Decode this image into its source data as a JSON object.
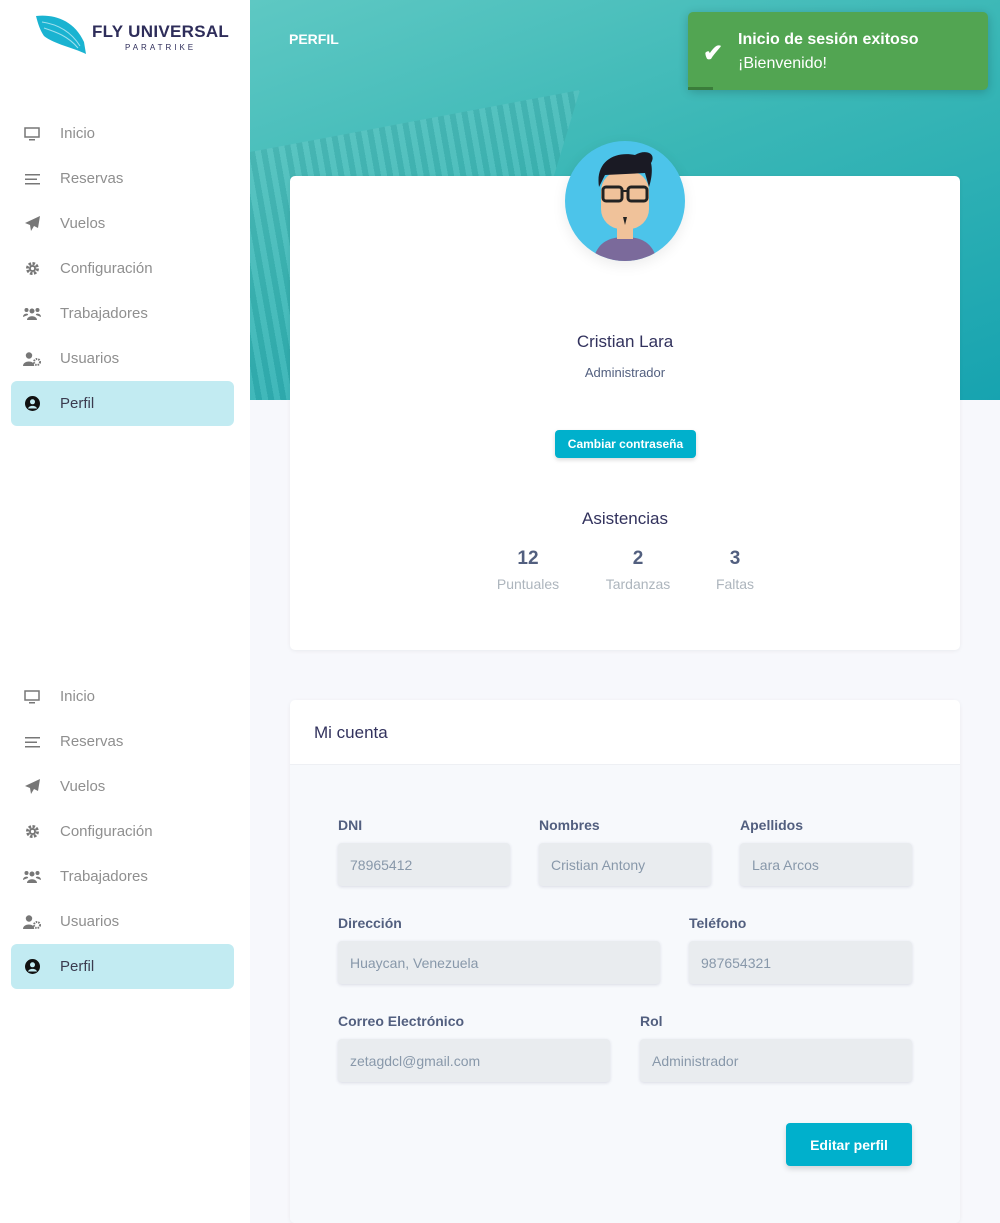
{
  "brand": {
    "name": "FLY UNIVERSAL",
    "tagline": "PARATRIKE"
  },
  "sidebar": {
    "items": [
      {
        "label": "Inicio",
        "icon": "monitor-icon"
      },
      {
        "label": "Reservas",
        "icon": "list-icon"
      },
      {
        "label": "Vuelos",
        "icon": "paper-plane-icon"
      },
      {
        "label": "Configuración",
        "icon": "gear-icon"
      },
      {
        "label": "Trabajadores",
        "icon": "users-icon"
      },
      {
        "label": "Usuarios",
        "icon": "user-cog-icon"
      },
      {
        "label": "Perfil",
        "icon": "user-circle-icon",
        "active": true
      }
    ]
  },
  "header": {
    "title": "PERFIL"
  },
  "toast": {
    "title": "Inicio de sesión exitoso",
    "message": "¡Bienvenido!",
    "color": "#52a552"
  },
  "profile": {
    "name": "Cristian Lara",
    "role": "Administrador",
    "change_password": "Cambiar contraseña",
    "attendance_title": "Asistencias",
    "stats": [
      {
        "value": "12",
        "label": "Puntuales"
      },
      {
        "value": "2",
        "label": "Tardanzas"
      },
      {
        "value": "3",
        "label": "Faltas"
      }
    ]
  },
  "account": {
    "title": "Mi cuenta",
    "fields": {
      "dni": {
        "label": "DNI",
        "value": "78965412"
      },
      "nombres": {
        "label": "Nombres",
        "value": "Cristian Antony"
      },
      "apellidos": {
        "label": "Apellidos",
        "value": "Lara Arcos"
      },
      "direccion": {
        "label": "Dirección",
        "value": "Huaycan, Venezuela"
      },
      "telefono": {
        "label": "Teléfono",
        "value": "987654321"
      },
      "correo": {
        "label": "Correo Electrónico",
        "value": "zetagdcl@gmail.com"
      },
      "rol": {
        "label": "Rol",
        "value": "Administrador"
      }
    },
    "edit_button": "Editar perfil"
  },
  "colors": {
    "accent": "#00b0cc",
    "active_nav": "#c2ebf2"
  }
}
